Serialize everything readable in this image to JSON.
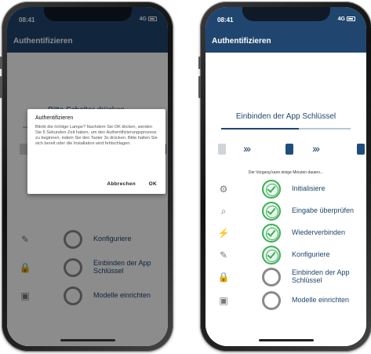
{
  "status": {
    "time": "08:41",
    "signal": "4G"
  },
  "appbar": {
    "title": "Authentifizieren"
  },
  "left": {
    "headline": "Bitte Schalter drücken.",
    "chevrons": "›››",
    "dialog": {
      "title": "Authentifizieren",
      "body": "Blinkt die richtige Lampe? Nachdem Sie OK klicken, werden Sie 5 Sekunden Zeit haben, um den Authentifizierungsprozess zu beginnen, indem Sie den Taster 3x drücken. Bitte halten Sie sich bereit oder die Installation wird fehlschlagen.",
      "cancel": "Abbrechen",
      "ok": "OK"
    },
    "steps": [
      {
        "label": "Konfiguriere",
        "icon": "puzzle-icon"
      },
      {
        "label": "Einbinden der App Schlüssel",
        "icon": "lock-icon"
      },
      {
        "label": "Modelle einrichten",
        "icon": "device-icon"
      }
    ]
  },
  "right": {
    "headline": "Einbinden der App Schlüssel",
    "progress": 0.6,
    "chevrons": "›››",
    "note": "Der Vorgang kann einige Minuten dauern...",
    "steps": [
      {
        "label": "Initialisiere",
        "state": "done",
        "icon": "gear-icon"
      },
      {
        "label": "Eingabe überprüfen",
        "state": "done",
        "icon": "magnifier-icon"
      },
      {
        "label": "Wiederverbinden",
        "state": "done",
        "icon": "plug-icon"
      },
      {
        "label": "Konfiguriere",
        "state": "done",
        "icon": "puzzle-icon"
      },
      {
        "label": "Einbinden der App Schlüssel",
        "state": "pending",
        "icon": "lock-icon"
      },
      {
        "label": "Modelle einrichten",
        "state": "pending",
        "icon": "device-icon"
      }
    ]
  },
  "colors": {
    "brand": "#20466f",
    "success": "#3dae57",
    "pending": "#8a8a8a"
  }
}
